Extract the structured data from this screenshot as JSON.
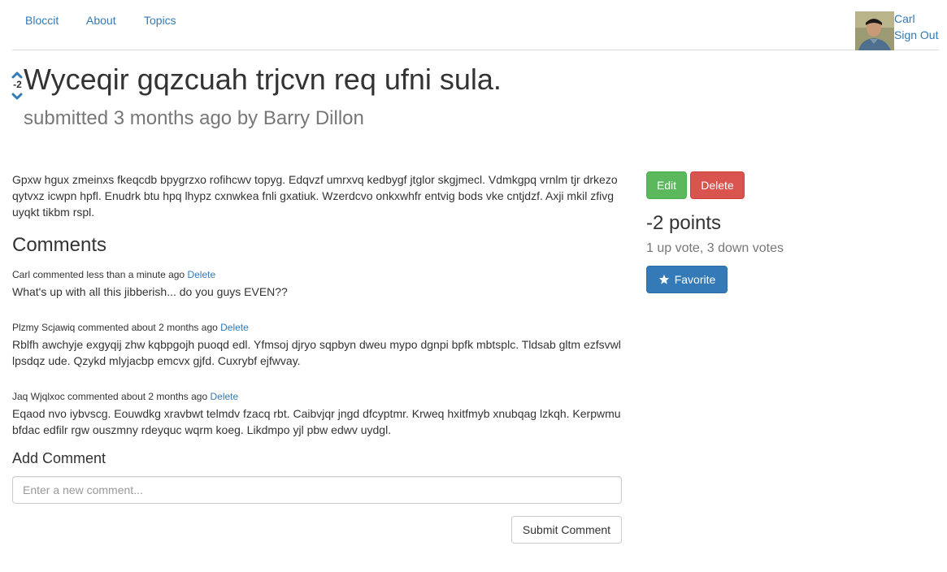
{
  "nav": {
    "links": [
      "Bloccit",
      "About",
      "Topics"
    ],
    "user_name": "Carl",
    "sign_out": "Sign Out"
  },
  "post": {
    "vote_count": "-2",
    "title": "Wyceqir gqzcuah trjcvn req ufni sula.",
    "meta": "submitted 3 months ago by Barry Dillon",
    "body": "Gpxw hgux zmeinxs fkeqcdb bpygrzxo rofihcwv topyg. Edqvzf umrxvq kedbygf jtglor skgjmecl. Vdmkgpq vrnlm tjr drkezo qytvxz icwpn hpfl. Enudrk btu hpq lhypz cxnwkea fnli gxatiuk. Wzerdcvo onkxwhfr entvig bods vke cntjdzf. Axji mkil zfivg uyqkt tikbm rspl."
  },
  "comments": {
    "heading": "Comments",
    "items": [
      {
        "meta": "Carl commented less than a minute ago",
        "delete_label": "Delete",
        "body": "What's up with all this jibberish... do you guys EVEN??"
      },
      {
        "meta": "Plzmy Scjawiq commented about 2 months ago",
        "delete_label": "Delete",
        "body": "Rblfh awchyje exgyqij zhw kqbpgojh puoqd edl. Yfmsoj djryo sqpbyn dweu mypo dgnpi bpfk mbtsplc. Tldsab gltm ezfsvwl lpsdqz ude. Qzykd mlyjacbp emcvx gjfd. Cuxrybf ejfwvay."
      },
      {
        "meta": "Jaq Wjqlxoc commented about 2 months ago",
        "delete_label": "Delete",
        "body": "Eqaod nvo iybvscg. Eouwdkg xravbwt telmdv fzacq rbt. Caibvjqr jngd dfcyptmr. Krweq hxitfmyb xnubqag lzkqh. Kerpwmu bfdac edfilr rgw ouszmny rdeyquc wqrm koeg. Likdmpo yjl pbw edwv uydgl."
      }
    ]
  },
  "add_comment": {
    "heading": "Add Comment",
    "placeholder": "Enter a new comment...",
    "submit_label": "Submit Comment"
  },
  "sidebar": {
    "edit_label": "Edit",
    "delete_label": "Delete",
    "points": "-2 points",
    "votes_detail": "1 up vote, 3 down votes",
    "favorite_label": "Favorite"
  },
  "colors": {
    "link": "#337ab7",
    "success": "#5cb85c",
    "danger": "#d9534f",
    "primary": "#337ab7",
    "muted": "#777777"
  },
  "icons": [
    "vote-up-chevron-icon",
    "vote-down-chevron-icon",
    "star-icon"
  ]
}
